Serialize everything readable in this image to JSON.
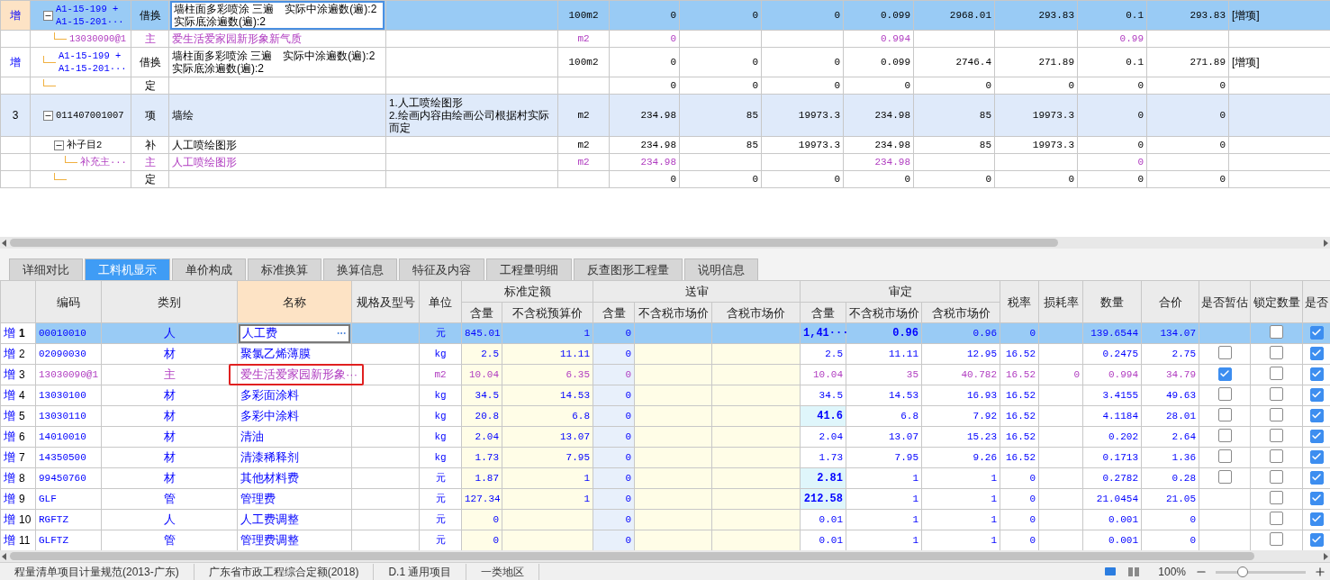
{
  "top_table": {
    "rows": [
      {
        "flag": "增",
        "code": "A1-15-199 +\nA1-15-201···",
        "kind": "sub",
        "type": "借换",
        "name": "墙柱面多彩喷涂 三遍　实际中涂遍数(遍):2\n 实际底涂遍数(遍):2",
        "unit": "100m2",
        "values": {
          "column_7": "0",
          "column_8": "0",
          "column_9": "0",
          "column_10": "0.099",
          "column_11": "2968.01",
          "column_12": "293.83",
          "column_13": "0.1",
          "column_14": "293.83"
        },
        "note": "[增项]",
        "selected": true,
        "expanded": true,
        "children": [
          {
            "code": "13030090@1",
            "kind": "main",
            "type": "主",
            "name": "爱生活爱家园新形象新气质",
            "unit": "m2",
            "values": {
              "column_7": "0",
              "column_10": "0.994",
              "column_13": "0.99"
            },
            "selected": false
          }
        ]
      },
      {
        "flag": "增",
        "code": "A1-15-199 +\nA1-15-201···",
        "kind": "sub",
        "type": "借换",
        "name": "墙柱面多彩喷涂 三遍　实际中涂遍数(遍):2\n 实际底涂遍数(遍):2",
        "unit": "100m2",
        "values": {
          "column_7": "0",
          "column_8": "0",
          "column_9": "0",
          "column_10": "0.099",
          "column_11": "2746.4",
          "column_12": "271.89",
          "column_13": "0.1",
          "column_14": "271.89"
        },
        "note": "[增项]",
        "selected": false
      },
      {
        "kind": "quota",
        "type": "定",
        "values": {
          "column_7": "0",
          "column_8": "0",
          "column_9": "0",
          "column_10": "0",
          "column_11": "0",
          "column_12": "0",
          "column_13": "0",
          "column_14": "0"
        },
        "selected": false
      },
      {
        "flag": "3",
        "code": "011407001007",
        "kind": "item",
        "type": "项",
        "name": "墙绘",
        "feature": [
          "1.人工喷绘图形",
          "2.绘画内容由绘画公司根据村实际而定"
        ],
        "unit": "m2",
        "values": {
          "column_7": "234.98",
          "column_8": "85",
          "column_9": "19973.3",
          "column_10": "234.98",
          "column_11": "85",
          "column_12": "19973.3",
          "column_13": "0",
          "column_14": "0"
        },
        "selected": false,
        "expanded": true,
        "children": [
          {
            "code": "补子目2",
            "kind": "supplement",
            "type": "补",
            "name": "人工喷绘图形",
            "unit": "m2",
            "values": {
              "column_7": "234.98",
              "column_8": "85",
              "column_9": "19973.3",
              "column_10": "234.98",
              "column_11": "85",
              "column_12": "19973.3",
              "column_13": "0",
              "column_14": "0"
            },
            "selected": false,
            "expanded": true,
            "children": [
              {
                "code": "补充主···",
                "kind": "main",
                "type": "主",
                "name": "人工喷绘图形",
                "unit": "m2",
                "values": {
                  "column_7": "234.98",
                  "column_10": "234.98",
                  "column_13": "0"
                },
                "selected": false
              }
            ]
          },
          {
            "kind": "quota",
            "type": "定",
            "values": {
              "column_7": "0",
              "column_8": "0",
              "column_9": "0",
              "column_10": "0",
              "column_11": "0",
              "column_12": "0",
              "column_13": "0",
              "column_14": "0"
            },
            "selected": false
          }
        ]
      }
    ]
  },
  "tabs": [
    {
      "label": "详细对比",
      "selected": false
    },
    {
      "label": "工料机显示",
      "selected": true
    },
    {
      "label": "单价构成",
      "selected": false
    },
    {
      "label": "标准换算",
      "selected": false
    },
    {
      "label": "换算信息",
      "selected": false
    },
    {
      "label": "特征及内容",
      "selected": false
    },
    {
      "label": "工程量明细",
      "selected": false
    },
    {
      "label": "反查图形工程量",
      "selected": false
    },
    {
      "label": "说明信息",
      "selected": false
    }
  ],
  "bottom_table": {
    "columns": [
      {
        "label": "编码"
      },
      {
        "label": "类别"
      },
      {
        "label": "名称",
        "selected": true
      },
      {
        "label": "规格及型号"
      },
      {
        "label": "单位"
      },
      {
        "label": "标准定额",
        "children": [
          "含量",
          "不含税预算价"
        ]
      },
      {
        "label": "送审",
        "children": [
          "含量",
          "不含税市场价",
          "含税市场价"
        ]
      },
      {
        "label": "审定",
        "children": [
          "含量",
          "不含税市场价",
          "含税市场价"
        ]
      },
      {
        "label": "税率"
      },
      {
        "label": "损耗率"
      },
      {
        "label": "数量"
      },
      {
        "label": "合价"
      },
      {
        "label": "是否暂估"
      },
      {
        "label": "锁定数量"
      },
      {
        "label": "是否"
      }
    ],
    "rows": [
      {
        "flag": "增",
        "index": "1",
        "code": "00010010",
        "category": "人",
        "name": "人工费",
        "unit": "元",
        "std_qty": "845.01",
        "std_price": "1",
        "sub_qty": "0",
        "aud_qty": "1,41···",
        "aud_price_ex": "0.96",
        "aud_price_in": "0.96",
        "tax_rate": "0",
        "quantity": "139.6544",
        "total": "134.07",
        "selected": true,
        "qty_changed": true,
        "price_changed": true,
        "locked": false,
        "included": true
      },
      {
        "flag": "增",
        "index": "2",
        "code": "02090030",
        "category": "材",
        "name": "聚氯乙烯薄膜",
        "unit": "kg",
        "std_qty": "2.5",
        "std_price": "11.11",
        "sub_qty": "0",
        "aud_qty": "2.5",
        "aud_price_ex": "11.11",
        "aud_price_in": "12.95",
        "tax_rate": "16.52",
        "quantity": "0.2475",
        "total": "2.75",
        "selected": false,
        "qty_changed": false,
        "estimated": false,
        "locked": false,
        "included": true
      },
      {
        "flag": "增",
        "index": "3",
        "code": "13030090@1",
        "kind": "main",
        "category": "主",
        "name": "爱生活爱家园新形象···",
        "unit": "m2",
        "std_qty": "10.04",
        "std_price": "6.35",
        "sub_qty": "0",
        "aud_qty": "10.04",
        "aud_price_ex": "35",
        "aud_price_in": "40.782",
        "tax_rate": "16.52",
        "loss_rate": "0",
        "quantity": "0.994",
        "total": "34.79",
        "selected": false,
        "qty_changed": false,
        "estimated": true,
        "locked": false,
        "included": true,
        "annotated": true
      },
      {
        "flag": "增",
        "index": "4",
        "code": "13030100",
        "category": "材",
        "name": "多彩面涂料",
        "unit": "kg",
        "std_qty": "34.5",
        "std_price": "14.53",
        "sub_qty": "0",
        "aud_qty": "34.5",
        "aud_price_ex": "14.53",
        "aud_price_in": "16.93",
        "tax_rate": "16.52",
        "quantity": "3.4155",
        "total": "49.63",
        "selected": false,
        "qty_changed": false,
        "estimated": false,
        "locked": false,
        "included": true
      },
      {
        "flag": "增",
        "index": "5",
        "code": "13030110",
        "category": "材",
        "name": "多彩中涂料",
        "unit": "kg",
        "std_qty": "20.8",
        "std_price": "6.8",
        "sub_qty": "0",
        "aud_qty": "41.6",
        "aud_price_ex": "6.8",
        "aud_price_in": "7.92",
        "tax_rate": "16.52",
        "quantity": "4.1184",
        "total": "28.01",
        "selected": false,
        "qty_changed": true,
        "estimated": false,
        "locked": false,
        "included": true
      },
      {
        "flag": "增",
        "index": "6",
        "code": "14010010",
        "category": "材",
        "name": "清油",
        "unit": "kg",
        "std_qty": "2.04",
        "std_price": "13.07",
        "sub_qty": "0",
        "aud_qty": "2.04",
        "aud_price_ex": "13.07",
        "aud_price_in": "15.23",
        "tax_rate": "16.52",
        "quantity": "0.202",
        "total": "2.64",
        "selected": false,
        "qty_changed": false,
        "estimated": false,
        "locked": false,
        "included": true
      },
      {
        "flag": "增",
        "index": "7",
        "code": "14350500",
        "category": "材",
        "name": "清漆稀释剂",
        "unit": "kg",
        "std_qty": "1.73",
        "std_price": "7.95",
        "sub_qty": "0",
        "aud_qty": "1.73",
        "aud_price_ex": "7.95",
        "aud_price_in": "9.26",
        "tax_rate": "16.52",
        "quantity": "0.1713",
        "total": "1.36",
        "selected": false,
        "qty_changed": false,
        "estimated": false,
        "locked": false,
        "included": true
      },
      {
        "flag": "增",
        "index": "8",
        "code": "99450760",
        "category": "材",
        "name": "其他材料费",
        "unit": "元",
        "std_qty": "1.87",
        "std_price": "1",
        "sub_qty": "0",
        "aud_qty": "2.81",
        "aud_price_ex": "1",
        "aud_price_in": "1",
        "tax_rate": "0",
        "quantity": "0.2782",
        "total": "0.28",
        "selected": false,
        "qty_changed": true,
        "estimated": false,
        "locked": false,
        "included": true
      },
      {
        "flag": "增",
        "index": "9",
        "code": "GLF",
        "category": "管",
        "name": "管理费",
        "unit": "元",
        "std_qty": "127.34",
        "std_price": "1",
        "sub_qty": "0",
        "aud_qty": "212.58",
        "aud_price_ex": "1",
        "aud_price_in": "1",
        "tax_rate": "0",
        "quantity": "21.0454",
        "total": "21.05",
        "selected": false,
        "qty_changed": true,
        "locked": false,
        "included": true
      },
      {
        "flag": "增",
        "index": "10",
        "code": "RGFTZ",
        "category": "人",
        "name": "人工费调整",
        "unit": "元",
        "std_qty": "0",
        "sub_qty": "0",
        "aud_qty": "0.01",
        "aud_price_ex": "1",
        "aud_price_in": "1",
        "tax_rate": "0",
        "quantity": "0.001",
        "total": "0",
        "selected": false,
        "qty_changed": false,
        "locked": false,
        "included": true
      },
      {
        "flag": "增",
        "index": "11",
        "code": "GLFTZ",
        "category": "管",
        "name": "管理费调整",
        "unit": "元",
        "std_qty": "0",
        "sub_qty": "0",
        "aud_qty": "0.01",
        "aud_price_ex": "1",
        "aud_price_in": "1",
        "tax_rate": "0",
        "quantity": "0.001",
        "total": "0",
        "selected": false,
        "qty_changed": false,
        "locked": false,
        "included": true
      }
    ]
  },
  "status_bar": {
    "items": [
      "程量清单项目计量规范(2013-广东)",
      "广东省市政工程综合定额(2018)",
      "D.1 通用项目",
      "一类地区"
    ],
    "zoom": {
      "label": "100%",
      "level": 0.3
    }
  }
}
